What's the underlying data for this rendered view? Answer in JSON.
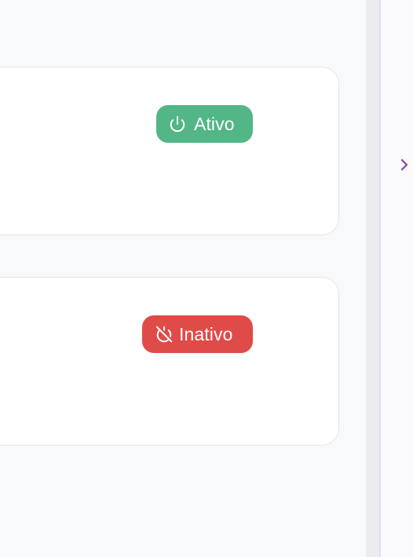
{
  "status_cards": [
    {
      "status_label": "Ativo",
      "color": "#52b686",
      "icon": "power-icon"
    },
    {
      "status_label": "Inativo",
      "color": "#df4b48",
      "icon": "power-off-icon"
    }
  ],
  "side_panel": {
    "toggle_icon": "chevron-right-icon",
    "accent_color": "#8a5aa6"
  }
}
